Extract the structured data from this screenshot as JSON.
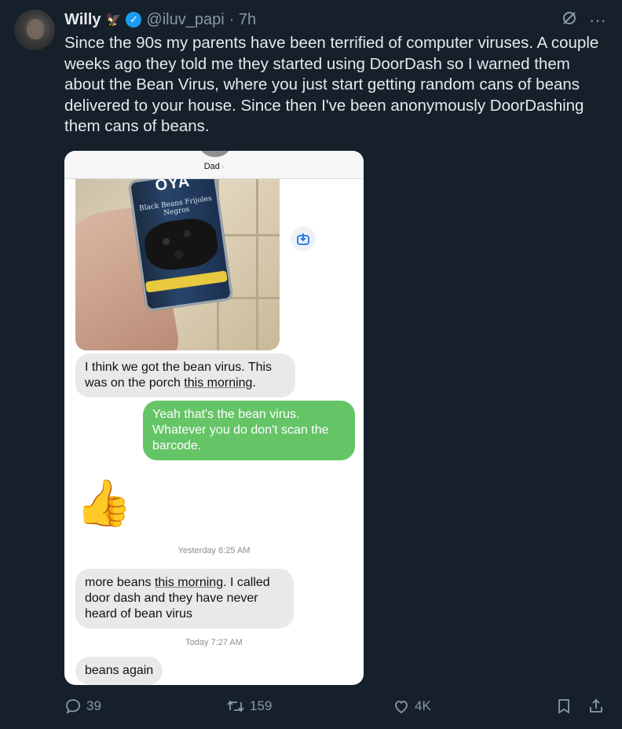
{
  "author": {
    "name": "Willy",
    "badge_icon": "eagle-icon",
    "verified": true,
    "handle": "@iluv_papi",
    "time": "· 7h"
  },
  "tweet": {
    "text": "Since the 90s my parents have been terrified of computer viruses. A couple weeks ago they told me they started using DoorDash so I warned them about the Bean Virus, where you just start getting random cans of beans delivered to your house. Since then I've been anonymously DoorDashing them cans of beans."
  },
  "top_icons": [
    "grok-slash-icon",
    "more-options-icon"
  ],
  "more_label": "···",
  "screenshot": {
    "contact": "Dad",
    "photo_can_brand": "OYA",
    "photo_can_sub": "Black Beans Frijoles Negros",
    "messages": [
      {
        "dir": "in",
        "text_a": "I think we got the bean virus. This was on the porch ",
        "text_u": "this morning",
        "text_b": "."
      },
      {
        "dir": "out",
        "text": "Yeah that's the bean virus. Whatever you do don't scan the barcode."
      },
      {
        "dir": "in",
        "emoji": "👍"
      },
      {
        "dir": "in",
        "text_a": "more beans ",
        "text_u": "this morning",
        "text_b": ". I called door dash and they have never heard of bean virus"
      },
      {
        "dir": "in",
        "text": "beans again"
      }
    ],
    "timestamps": {
      "yesterday": "Yesterday 8:25 AM",
      "today": "Today 7:27 AM"
    }
  },
  "actions": {
    "replies": "39",
    "reposts": "159",
    "likes": "4K"
  },
  "colors": {
    "background": "#15202b",
    "text": "#e7e9ea",
    "muted": "#8b98a5",
    "verified": "#1d9bf0",
    "imessage_green": "#65c466",
    "incoming_gray": "#e9e9eb"
  }
}
